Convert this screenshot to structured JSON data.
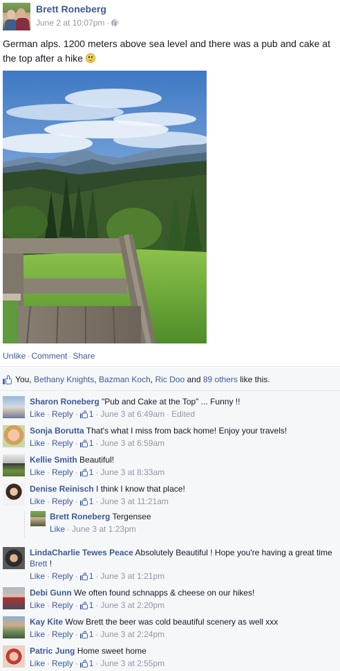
{
  "post": {
    "author": "Brett Roneberg",
    "timestamp": "June 2 at 10:07pm",
    "meta_separator": "·",
    "text": "German alps. 1200 meters above sea level and there was a pub and cake at the top after a hike",
    "actions": {
      "unlike": "Unlike",
      "comment": "Comment",
      "share": "Share",
      "separator": "·"
    }
  },
  "likes": {
    "prefix": "You,",
    "names": [
      "Bethany Knights",
      "Bazman Koch",
      "Ric Doo"
    ],
    "and_text": "and",
    "others": "89 others",
    "suffix": "like this.",
    "comma": ","
  },
  "comment_meta": {
    "like": "Like",
    "reply": "Reply",
    "dot": "·"
  },
  "comments": [
    {
      "name": "Sharon Roneberg",
      "text": "\"Pub and Cake at the Top\" ... Funny !!",
      "likes": "1",
      "time": "June 3 at 6:49am",
      "edited": "Edited"
    },
    {
      "name": "Sonja Borutta",
      "text": "That's what I miss from back home! Enjoy your travels!",
      "likes": "1",
      "time": "June 3 at 6:59am"
    },
    {
      "name": "Kellie Smith",
      "text": "Beautiful!",
      "likes": "1",
      "time": "June 3 at 8:33am"
    },
    {
      "name": "Denise Reinisch",
      "text": "I think I know that place!",
      "likes": "1",
      "time": "June 3 at 11:21am"
    },
    {
      "name": "LindaCharlie Tewes Peace",
      "text": "Absolutely Beautiful ! Hope you're having a great time",
      "mention": "Brett",
      "text_after": "!",
      "likes": "1",
      "time": "June 3 at 1:21pm"
    },
    {
      "name": "Debi Gunn",
      "text": "We often found schnapps & cheese on our hikes!",
      "likes": "1",
      "time": "June 3 at 2:20pm"
    },
    {
      "name": "Kay Kite",
      "text": "Wow Brett the beer was cold beautiful scenery as well xxx",
      "likes": "1",
      "time": "June 3 at 2:24pm"
    },
    {
      "name": "Patric Jung",
      "text": "Home sweet home",
      "likes": "1",
      "time": "June 3 at 2:55pm"
    }
  ],
  "reply": {
    "name": "Brett Roneberg",
    "text": "Tergensee",
    "like": "Like",
    "time": "June 3 at 1:23pm",
    "dot": "·"
  },
  "colors": {
    "link": "#3b5998",
    "meta": "#9197a3",
    "comment_bg": "#f6f7f9"
  }
}
